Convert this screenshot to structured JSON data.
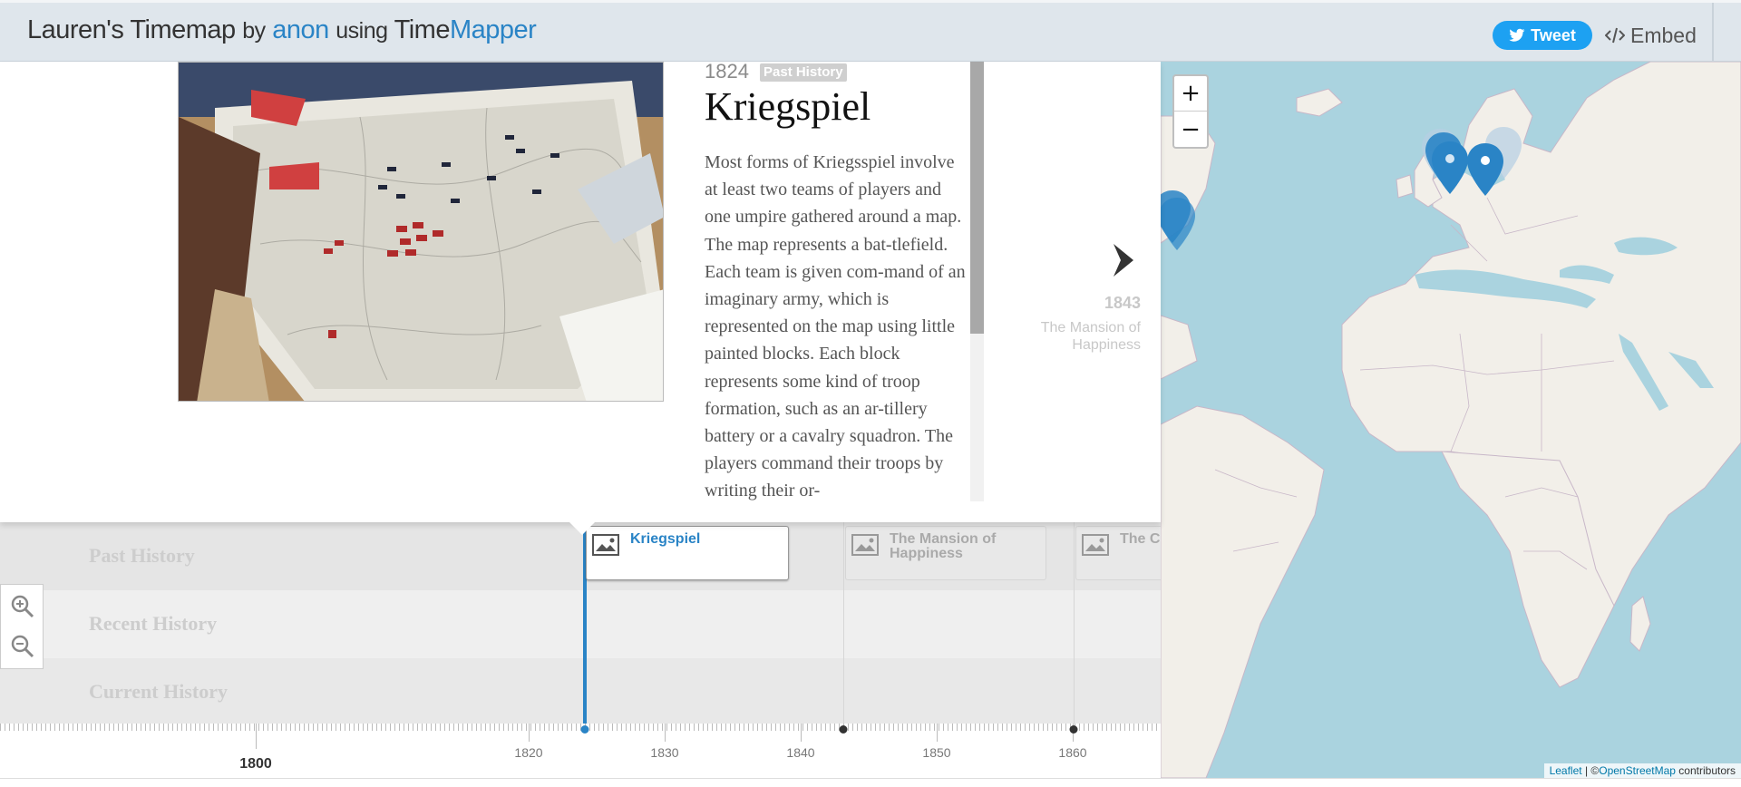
{
  "header": {
    "title": "Lauren's Timemap",
    "by_text": "by",
    "author": "anon",
    "using_text": "using",
    "app_name_a": "Time",
    "app_name_b": "Mapper",
    "tweet_label": "Tweet",
    "embed_label": "Embed"
  },
  "story": {
    "year": "1824",
    "tag": "Past History",
    "title": "Kriegspiel",
    "text": "Most forms of Kriegsspiel involve at least two teams of players and one umpire gathered around a map. The map represents a bat-tlefield. Each team is given com-mand of an imaginary army, which is represented on the map using little painted blocks. Each block represents some kind of troop formation, such as an ar-tillery battery or a cavalry squadron. The players command their troops by writing their or-",
    "next_year": "1843",
    "next_title": "The Mansion of Happiness"
  },
  "timeline": {
    "bands": [
      "Past History",
      "Recent History",
      "Current History"
    ],
    "events": [
      {
        "title": "Kriegspiel",
        "active": true
      },
      {
        "title": "The Mansion of Happiness",
        "active": false
      },
      {
        "title": "The Checkered Game of Life",
        "active": false
      }
    ],
    "axis_labels": [
      "1800",
      "1820",
      "1830",
      "1840",
      "1850",
      "1860"
    ]
  },
  "map": {
    "zoom_in": "+",
    "zoom_out": "−",
    "attribution_leaflet": "Leaflet",
    "attribution_sep": " | ©",
    "attribution_osm": "OpenStreetMap",
    "attribution_tail": " contributors"
  },
  "colors": {
    "accent": "#2a84c6",
    "tweet": "#1da1f2",
    "water": "#aad3df",
    "land": "#f2efe9"
  }
}
